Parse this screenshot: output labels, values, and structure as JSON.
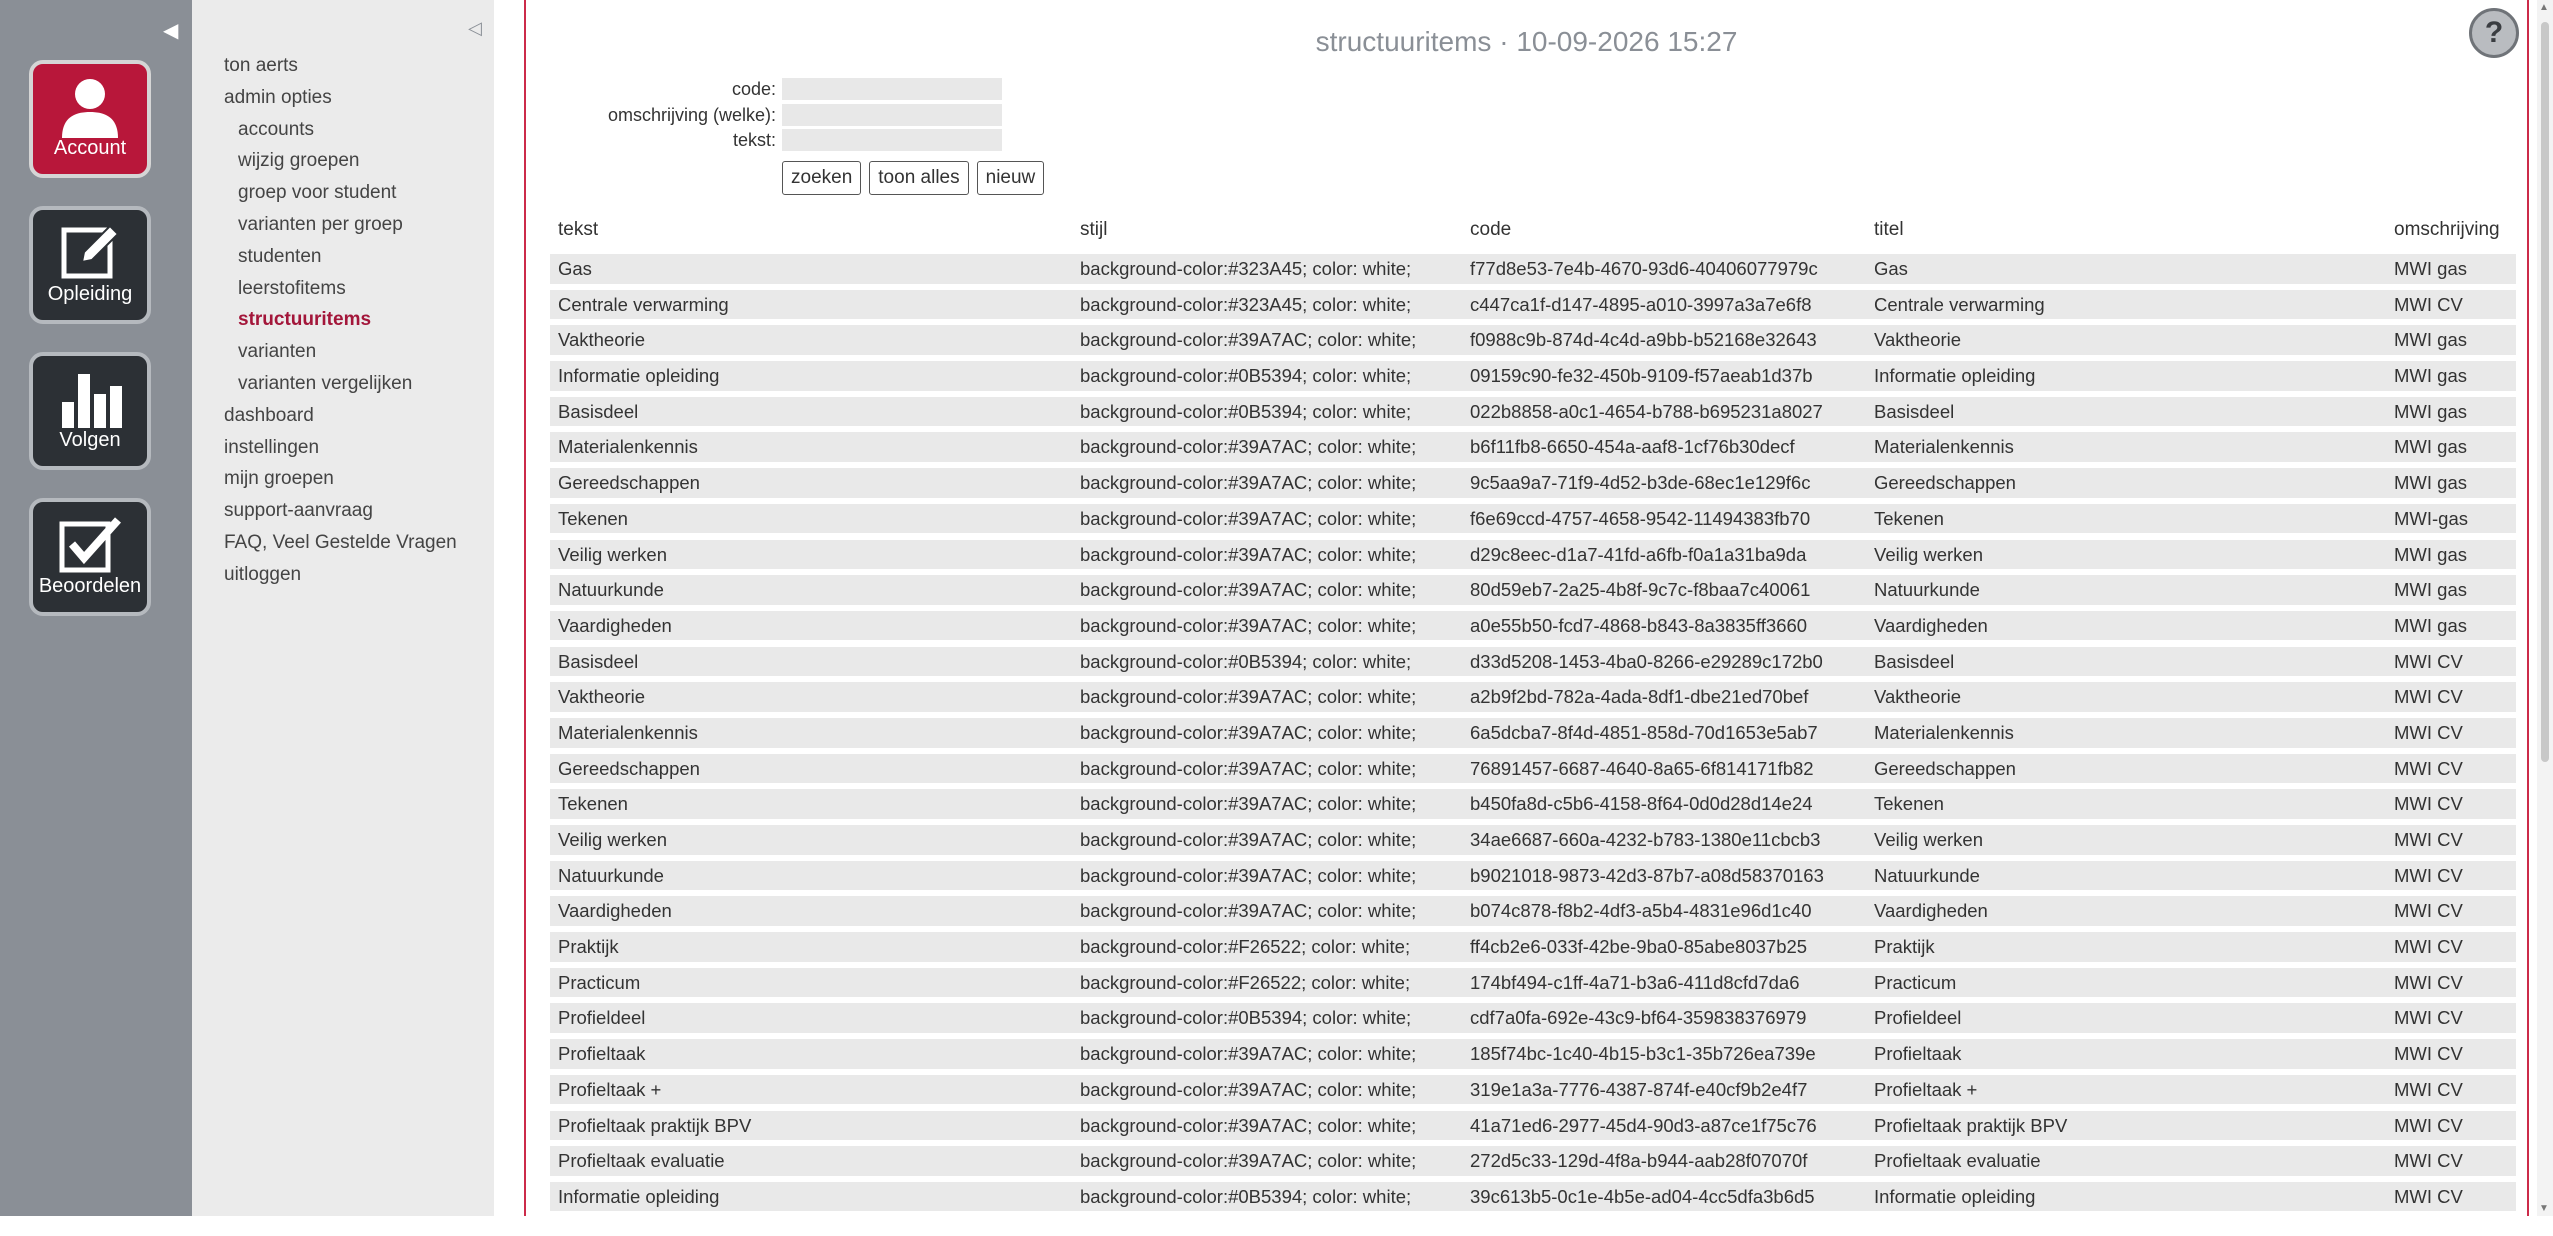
{
  "rail": {
    "buttons": [
      {
        "label": "Account",
        "icon": "user-icon"
      },
      {
        "label": "Opleiding",
        "icon": "edit-icon"
      },
      {
        "label": "Volgen",
        "icon": "bar-chart-icon"
      },
      {
        "label": "Beoordelen",
        "icon": "checkbox-icon"
      }
    ],
    "active_color": "#b8173a"
  },
  "menu": {
    "items": [
      {
        "label": "ton aerts"
      },
      {
        "label": "admin opties"
      },
      {
        "label": "accounts"
      },
      {
        "label": "wijzig groepen"
      },
      {
        "label": "groep voor student"
      },
      {
        "label": "varianten per groep"
      },
      {
        "label": "studenten"
      },
      {
        "label": "leerstofitems"
      },
      {
        "label": "structuuritems"
      },
      {
        "label": "varianten"
      },
      {
        "label": "varianten vergelijken"
      },
      {
        "label": "dashboard"
      },
      {
        "label": "instellingen"
      },
      {
        "label": "mijn groepen"
      },
      {
        "label": "support-aanvraag"
      },
      {
        "label": "FAQ, Veel Gestelde Vragen"
      },
      {
        "label": "uitloggen"
      }
    ]
  },
  "header": {
    "title": "structuuritems · 10-09-2026 15:27",
    "help": "?"
  },
  "form": {
    "code_label": "code:",
    "omschrijving_label": "omschrijving (welke):",
    "tekst_label": "tekst:",
    "code_value": "",
    "omschrijving_value": "",
    "tekst_value": ""
  },
  "buttons": {
    "zoeken": "zoeken",
    "toon_alles": "toon alles",
    "nieuw": "nieuw"
  },
  "table": {
    "headers": [
      "tekst",
      "stijl",
      "code",
      "titel",
      "omschrijving"
    ],
    "rows": [
      [
        "Gas",
        "background-color:#323A45; color: white;",
        "f77d8e53-7e4b-4670-93d6-40406077979c",
        "Gas",
        "MWI gas"
      ],
      [
        "Centrale verwarming",
        "background-color:#323A45; color: white;",
        "c447ca1f-d147-4895-a010-3997a3a7e6f8",
        "Centrale verwarming",
        "MWI CV"
      ],
      [
        "Vaktheorie",
        "background-color:#39A7AC; color: white;",
        "f0988c9b-874d-4c4d-a9bb-b52168e32643",
        "Vaktheorie",
        "MWI gas"
      ],
      [
        "Informatie opleiding",
        "background-color:#0B5394; color: white;",
        "09159c90-fe32-450b-9109-f57aeab1d37b",
        "Informatie opleiding",
        "MWI gas"
      ],
      [
        "Basisdeel",
        "background-color:#0B5394; color: white;",
        "022b8858-a0c1-4654-b788-b695231a8027",
        "Basisdeel",
        "MWI gas"
      ],
      [
        "Materialenkennis",
        "background-color:#39A7AC; color: white;",
        "b6f11fb8-6650-454a-aaf8-1cf76b30decf",
        "Materialenkennis",
        "MWI gas"
      ],
      [
        "Gereedschappen",
        "background-color:#39A7AC; color: white;",
        "9c5aa9a7-71f9-4d52-b3de-68ec1e129f6c",
        "Gereedschappen",
        "MWI gas"
      ],
      [
        "Tekenen",
        "background-color:#39A7AC; color: white;",
        "f6e69ccd-4757-4658-9542-11494383fb70",
        "Tekenen",
        "MWI-gas"
      ],
      [
        "Veilig werken",
        "background-color:#39A7AC; color: white;",
        "d29c8eec-d1a7-41fd-a6fb-f0a1a31ba9da",
        "Veilig werken",
        "MWI gas"
      ],
      [
        "Natuurkunde",
        "background-color:#39A7AC; color: white;",
        "80d59eb7-2a25-4b8f-9c7c-f8baa7c40061",
        "Natuurkunde",
        "MWI gas"
      ],
      [
        "Vaardigheden",
        "background-color:#39A7AC; color: white;",
        "a0e55b50-fcd7-4868-b843-8a3835ff3660",
        "Vaardigheden",
        "MWI gas"
      ],
      [
        "Basisdeel",
        "background-color:#0B5394; color: white;",
        "d33d5208-1453-4ba0-8266-e29289c172b0",
        "Basisdeel",
        "MWI CV"
      ],
      [
        "Vaktheorie",
        "background-color:#39A7AC; color: white;",
        "a2b9f2bd-782a-4ada-8df1-dbe21ed70bef",
        "Vaktheorie",
        "MWI CV"
      ],
      [
        "Materialenkennis",
        "background-color:#39A7AC; color: white;",
        "6a5dcba7-8f4d-4851-858d-70d1653e5ab7",
        "Materialenkennis",
        "MWI CV"
      ],
      [
        "Gereedschappen",
        "background-color:#39A7AC; color: white;",
        "76891457-6687-4640-8a65-6f814171fb82",
        "Gereedschappen",
        "MWI CV"
      ],
      [
        "Tekenen",
        "background-color:#39A7AC; color: white;",
        "b450fa8d-c5b6-4158-8f64-0d0d28d14e24",
        "Tekenen",
        "MWI CV"
      ],
      [
        "Veilig werken",
        "background-color:#39A7AC; color: white;",
        "34ae6687-660a-4232-b783-1380e11cbcb3",
        "Veilig werken",
        "MWI CV"
      ],
      [
        "Natuurkunde",
        "background-color:#39A7AC; color: white;",
        "b9021018-9873-42d3-87b7-a08d58370163",
        "Natuurkunde",
        "MWI CV"
      ],
      [
        "Vaardigheden",
        "background-color:#39A7AC; color: white;",
        "b074c878-f8b2-4df3-a5b4-4831e96d1c40",
        "Vaardigheden",
        "MWI CV"
      ],
      [
        "Praktijk",
        "background-color:#F26522; color: white;",
        "ff4cb2e6-033f-42be-9ba0-85abe8037b25",
        "Praktijk",
        "MWI CV"
      ],
      [
        "Practicum",
        "background-color:#F26522; color: white;",
        "174bf494-c1ff-4a71-b3a6-411d8cfd7da6",
        "Practicum",
        "MWI CV"
      ],
      [
        "Profieldeel",
        "background-color:#0B5394; color: white;",
        "cdf7a0fa-692e-43c9-bf64-359838376979",
        "Profieldeel",
        "MWI CV"
      ],
      [
        "Profieltaak",
        "background-color:#39A7AC; color: white;",
        "185f74bc-1c40-4b15-b3c1-35b726ea739e",
        "Profieltaak",
        "MWI CV"
      ],
      [
        "Profieltaak +",
        "background-color:#39A7AC; color: white;",
        "319e1a3a-7776-4387-874f-e40cf9b2e4f7",
        "Profieltaak +",
        "MWI CV"
      ],
      [
        "Profieltaak praktijk BPV",
        "background-color:#39A7AC; color: white;",
        "41a71ed6-2977-45d4-90d3-a87ce1f75c76",
        "Profieltaak praktijk BPV",
        "MWI CV"
      ],
      [
        "Profieltaak evaluatie",
        "background-color:#39A7AC; color: white;",
        "272d5c33-129d-4f8a-b944-aab28f07070f",
        "Profieltaak evaluatie",
        "MWI CV"
      ],
      [
        "Informatie opleiding",
        "background-color:#0B5394; color: white;",
        "39c613b5-0c1e-4b5e-ad04-4cc5dfa3b6d5",
        "Informatie opleiding",
        "MWI CV"
      ]
    ]
  }
}
